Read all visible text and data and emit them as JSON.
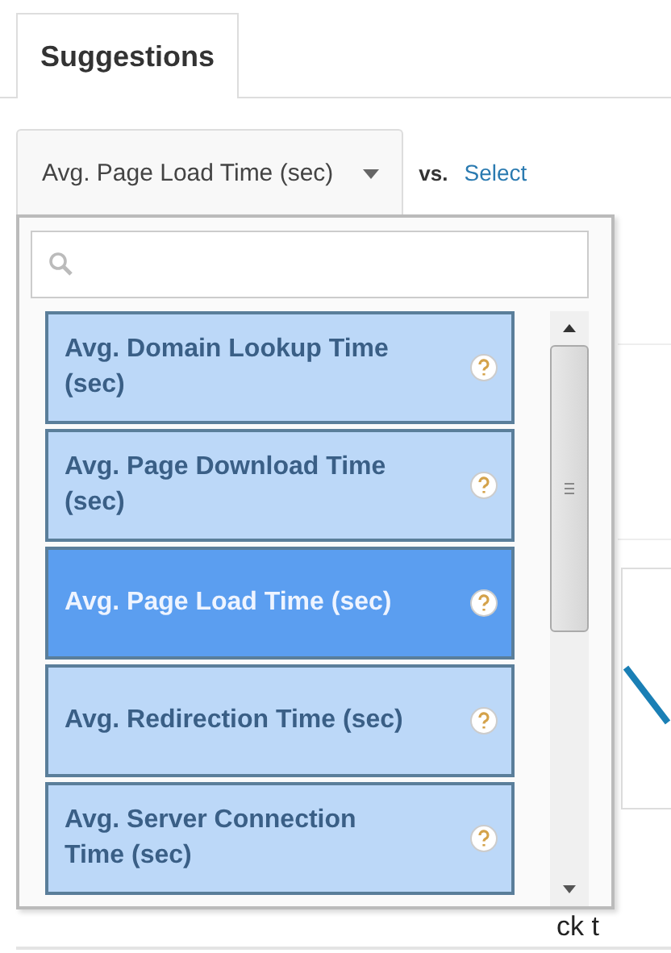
{
  "tabs": [
    {
      "label": "Suggestions",
      "selected": true
    }
  ],
  "metric_selector": {
    "value": "Avg. Page Load Time (sec)",
    "vs": "vs.",
    "compare_link": "Select"
  },
  "dropdown": {
    "items": [
      {
        "label": "Avg. Domain Lookup Time (sec)",
        "selected": false
      },
      {
        "label": "Avg. Page Download Time (sec)",
        "selected": false
      },
      {
        "label": "Avg. Page Load Time (sec)",
        "selected": true
      },
      {
        "label": "Avg. Redirection Time (sec)",
        "selected": false
      },
      {
        "label": "Avg. Server Connection Time (sec)",
        "selected": false
      }
    ]
  },
  "hint_fragment": "ck t"
}
